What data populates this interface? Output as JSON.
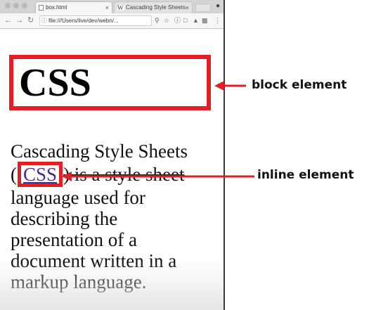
{
  "browser": {
    "tabs": [
      {
        "label": "box.html",
        "active": true
      },
      {
        "label": "Cascading Style Sheets",
        "active": false,
        "favicon": "W"
      }
    ],
    "tab_close_glyph": "×",
    "address": "file:///Users/live/dev/webn/...",
    "toolbar_icons": [
      "back-icon",
      "forward-icon",
      "reload-icon",
      "zoom-icon",
      "star-icon",
      "info-icon",
      "stop-icon",
      "extension-icon",
      "cast-icon",
      "menu-icon"
    ]
  },
  "page": {
    "heading": "CSS",
    "paragraph": {
      "lead": "Cascading Style Sheets",
      "open_paren": "(",
      "link": "CSS",
      "close_paren": ")",
      "struck": " is a style sheet",
      "rest": "language used for describing the presentation of a document written in a markup language."
    }
  },
  "annotations": {
    "block": "block  element",
    "inline": "inline  element",
    "color": "#e31e24"
  }
}
